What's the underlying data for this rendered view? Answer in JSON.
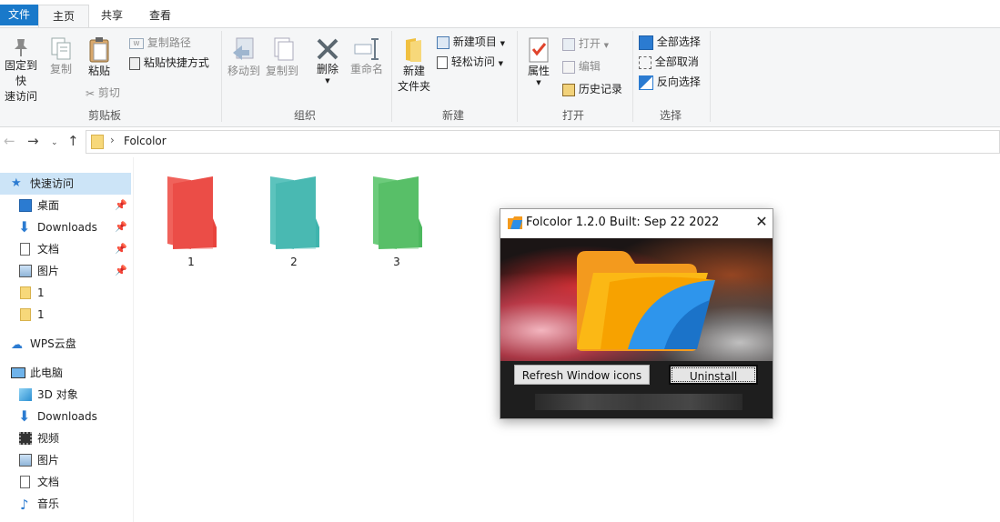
{
  "ribbon_tabs": {
    "file": "文件",
    "home": "主页",
    "share": "共享",
    "view": "查看"
  },
  "ribbon": {
    "clipboard": {
      "pin_label_1": "固定到快",
      "pin_label_2": "速访问",
      "copy": "复制",
      "paste": "粘贴",
      "copy_path": "复制路径",
      "paste_shortcut": "粘贴快捷方式",
      "cut": "剪切",
      "group_label": "剪贴板"
    },
    "organize": {
      "move_to": "移动到",
      "copy_to": "复制到",
      "delete": "删除",
      "rename": "重命名",
      "group_label": "组织"
    },
    "new": {
      "new_folder_1": "新建",
      "new_folder_2": "文件夹",
      "new_item": "新建项目",
      "easy_access": "轻松访问",
      "group_label": "新建"
    },
    "open": {
      "properties": "属性",
      "open": "打开",
      "edit": "编辑",
      "history": "历史记录",
      "group_label": "打开"
    },
    "select": {
      "select_all": "全部选择",
      "select_none": "全部取消",
      "invert": "反向选择",
      "group_label": "选择"
    }
  },
  "address": {
    "path_segment": "Folcolor"
  },
  "nav": {
    "quick_access": "快速访问",
    "desktop": "桌面",
    "downloads": "Downloads",
    "documents": "文档",
    "pictures": "图片",
    "folder1a": "1",
    "folder1b": "1",
    "wps": "WPS云盘",
    "this_pc": "此电脑",
    "objects3d": "3D 对象",
    "downloads2": "Downloads",
    "videos": "视频",
    "pictures2": "图片",
    "documents2": "文档",
    "music": "音乐"
  },
  "folders": [
    {
      "label": "1",
      "color": "#e8433c"
    },
    {
      "label": "2",
      "color": "#3fb4ad"
    },
    {
      "label": "3",
      "color": "#4db85f"
    }
  ],
  "dialog": {
    "title": "Folcolor 1.2.0 Built: Sep 22 2022",
    "refresh_button": "Refresh Window icons",
    "uninstall_button": "Uninstall"
  },
  "colors": {
    "accent": "#1979ca",
    "selection": "#cce4f7",
    "ribbon_bg": "#f5f6f7"
  }
}
